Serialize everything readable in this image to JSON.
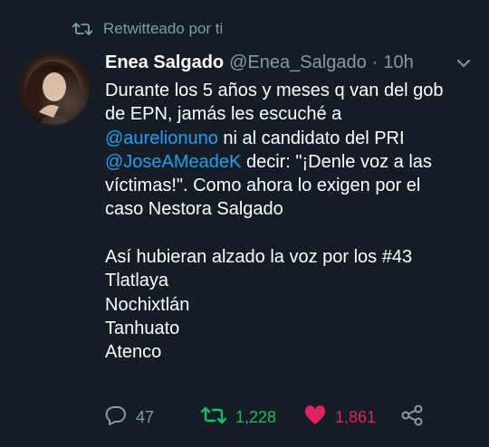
{
  "retweet_banner": {
    "label": "Retwitteado por ti"
  },
  "author": {
    "name": "Enea Salgado",
    "handle": "@Enea_Salgado",
    "separator": "·",
    "time": "10h"
  },
  "body": {
    "line1": "Durante los 5 años y meses q van del gob",
    "line2": "de EPN, jamás les escuché a",
    "mention1": "@aurelionuno",
    "line3_rest": " ni al candidato del PRI",
    "mention2": "@JoseAMeadeK",
    "line4_rest": " decir: \"¡Denle voz a las",
    "line5": "víctimas!\". Como ahora lo exigen por el",
    "line6": "caso Nestora Salgado",
    "line7": "Así hubieran alzado la voz por los #43",
    "line8": "Tlatlaya",
    "line9": "Nochixtlán",
    "line10": "Tanhuato",
    "line11": "Atenco"
  },
  "actions": {
    "replies": "47",
    "retweets": "1,228",
    "likes": "1,861"
  },
  "colors": {
    "background": "#141d26",
    "muted": "#8899a6",
    "mention": "#1da1f2",
    "retweet_active": "#17bf63",
    "like_active": "#e0245e"
  },
  "icons": {
    "banner": "retweet-icon",
    "menu": "chevron-down-icon",
    "reply": "reply-icon",
    "retweet": "retweet-icon",
    "like": "heart-icon",
    "share": "share-icon"
  }
}
